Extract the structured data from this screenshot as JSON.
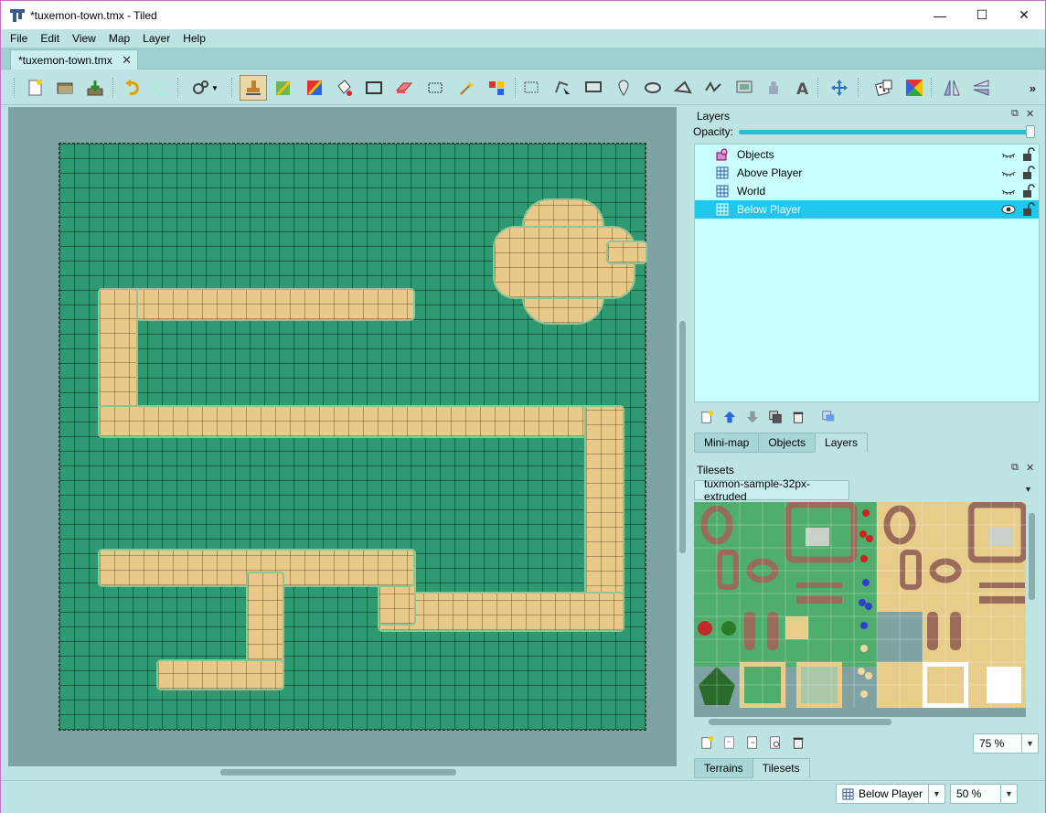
{
  "window": {
    "title": "*tuxemon-town.tmx - Tiled",
    "controls": [
      "—",
      "☐",
      "✕"
    ]
  },
  "menu": [
    "File",
    "Edit",
    "View",
    "Map",
    "Layer",
    "Help"
  ],
  "document_tab": {
    "label": "*tuxemon-town.tmx",
    "close": "✕"
  },
  "toolbar": {
    "more": "»",
    "tools": [
      "new-map-icon",
      "open-file-icon",
      "save-file-icon",
      "undo-icon",
      "redo-icon",
      "commands-icon",
      "stamp-brush-icon",
      "terrain-brush-icon",
      "wang-brush-icon",
      "bucket-fill-icon",
      "shape-fill-icon",
      "eraser-icon",
      "rectangular-select-icon",
      "magic-wand-icon",
      "select-same-tile-icon",
      "select-objects-icon",
      "edit-polygons-icon",
      "insert-rectangle-icon",
      "insert-point-icon",
      "insert-ellipse-icon",
      "insert-polygon-icon",
      "insert-polyline-icon",
      "insert-tile-icon",
      "insert-template-icon",
      "insert-text-icon",
      "move-icon",
      "random-mode-icon",
      "wang-fill-icon",
      "flip-horizontal-icon",
      "flip-vertical-icon"
    ]
  },
  "colors": {
    "grass": "#2f9a72",
    "path": "#e8c98a",
    "selection": "#1ec8ec",
    "chrome": "#bde3e3"
  },
  "layers_panel": {
    "title": "Layers",
    "opacity_label": "Opacity:",
    "opacity_value": 1.0,
    "layers": [
      {
        "name": "Objects",
        "icon": "object-layer-icon",
        "visible": false,
        "locked": false,
        "selected": false
      },
      {
        "name": "Above Player",
        "icon": "tile-layer-icon",
        "visible": false,
        "locked": false,
        "selected": false
      },
      {
        "name": "World",
        "icon": "tile-layer-icon",
        "visible": false,
        "locked": false,
        "selected": false
      },
      {
        "name": "Below Player",
        "icon": "tile-layer-icon",
        "visible": true,
        "locked": false,
        "selected": true
      }
    ],
    "tabs": [
      "Mini-map",
      "Objects",
      "Layers"
    ],
    "active_tab": "Layers"
  },
  "tilesets_panel": {
    "title": "Tilesets",
    "tileset_tab": "tuxmon-sample-32px-extruded",
    "zoom": "75 %",
    "tabs": [
      "Terrains",
      "Tilesets"
    ],
    "active_tab": "Tilesets"
  },
  "statusbar": {
    "current_layer": "Below Player",
    "zoom": "50 %"
  }
}
